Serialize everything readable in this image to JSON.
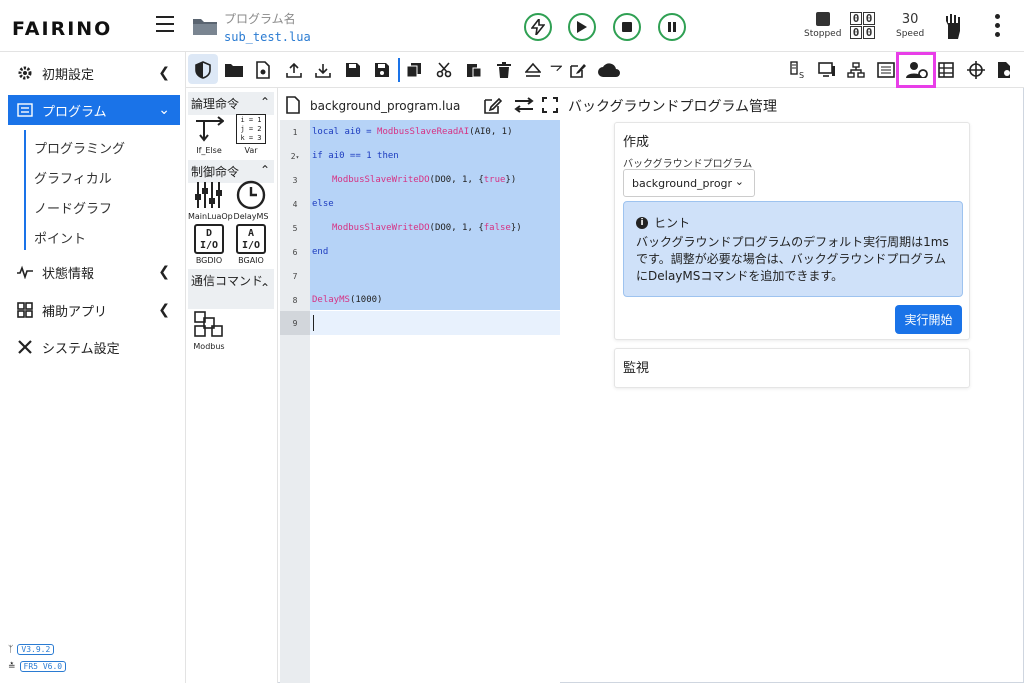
{
  "header": {
    "logo": "FAIRINO",
    "program_label": "プログラム名",
    "program_file": "sub_test.lua",
    "status_stopped": "Stopped",
    "speed_value": "30",
    "speed_label": "Speed",
    "digits": [
      "0",
      "0",
      "0",
      "0"
    ]
  },
  "sidebar": {
    "items": [
      {
        "label": "初期設定",
        "icon": "gear-icon"
      },
      {
        "label": "プログラム",
        "icon": "program-list-icon"
      },
      {
        "label": "状態情報",
        "icon": "pulse-icon"
      },
      {
        "label": "補助アプリ",
        "icon": "grid-apps-icon"
      },
      {
        "label": "システム設定",
        "icon": "tools-icon"
      }
    ],
    "sub_items": [
      "プログラミング",
      "グラフィカル",
      "ノードグラフ",
      "ポイント"
    ],
    "versions": [
      "V3.9.2",
      "FR5 V6.0"
    ]
  },
  "palette": {
    "sections": [
      {
        "title": "論理命令",
        "items": [
          "If_Else",
          "Var"
        ]
      },
      {
        "title": "制御命令",
        "items": [
          "MainLuaOp",
          "DelayMS",
          "BGDIO",
          "BGAIO"
        ]
      },
      {
        "title": "通信コマンド",
        "items": [
          "Modbus"
        ]
      }
    ],
    "var_text": [
      "i = 1",
      "j = 2",
      "k = 3"
    ],
    "io_d": [
      "D",
      "I/O"
    ],
    "io_a": [
      "A",
      "I/O"
    ]
  },
  "editor": {
    "filename": "background_program.lua",
    "line_numbers": [
      "1",
      "2",
      "3",
      "4",
      "5",
      "6",
      "7",
      "8",
      "9"
    ],
    "line1": {
      "kw": "local",
      "var": " ai0 = ",
      "fn": "ModbusSlaveReadAI",
      "rest": "(AI0, 1)"
    },
    "line2": {
      "kw": "if",
      "mid": " ai0 == 1 ",
      "kw2": "then"
    },
    "line3": {
      "fn": "ModbusSlaveWriteDO",
      "rest": "(DO0, 1, {",
      "bool": "true",
      "end": "})"
    },
    "line4": {
      "kw": "else"
    },
    "line5": {
      "fn": "ModbusSlaveWriteDO",
      "rest": "(DO0, 1, {",
      "bool": "false",
      "end": "})"
    },
    "line6": {
      "kw": "end"
    },
    "line8": {
      "fn": "DelayMS",
      "rest": "(1000)"
    }
  },
  "panel": {
    "title": "バックグラウンドプログラム管理",
    "create_title": "作成",
    "select_label": "バックグラウンドプログラム",
    "select_value": "background_progr",
    "hint_title": "ヒント",
    "hint_body": "バックグラウンドプログラムのデフォルト実行周期は1msです。調整が必要な場合は、バックグラウンドプログラムにDelayMSコマンドを追加できます。",
    "start_button": "実行開始",
    "monitor_title": "監視"
  },
  "colors": {
    "accent": "#1a73e8",
    "highlight": "#e83ee8",
    "control_green": "#2fa053"
  }
}
